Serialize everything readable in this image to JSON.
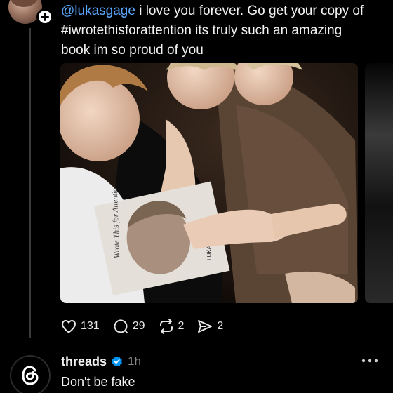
{
  "post": {
    "mention": "@lukasgage",
    "text_line1_rest": " i love you forever. Go get your copy of",
    "text_line2": "#iwrotethisforattention its truly such an amazing",
    "text_line3": "book im so proud of you"
  },
  "media": {
    "photo_book_title": "Wrote This for Attention",
    "photo_book_author": "LUKAS"
  },
  "actions": {
    "likes": "131",
    "replies": "29",
    "reposts": "2",
    "shares": "2"
  },
  "reply": {
    "username": "threads",
    "time": "1h",
    "text": "Don't be fake"
  },
  "colors": {
    "background": "#000000",
    "mention": "#5aa7ff",
    "verified": "#0095f6",
    "muted": "#8a8a8a"
  }
}
